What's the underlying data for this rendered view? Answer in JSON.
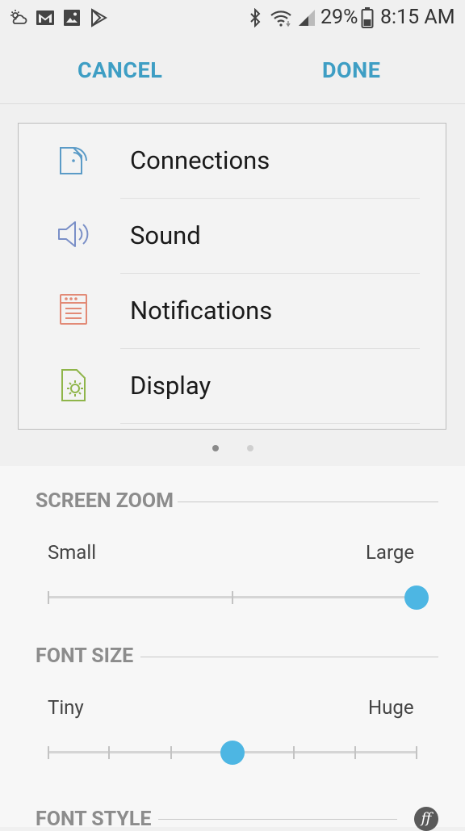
{
  "status_bar": {
    "battery_percent": "29%",
    "time": "8:15 AM",
    "left_icons": [
      "weather-icon",
      "gmail-icon",
      "gallery-icon",
      "play-store-icon"
    ],
    "right_icons": [
      "bluetooth-icon",
      "wifi-icon",
      "signal-icon",
      "battery-icon"
    ]
  },
  "action_bar": {
    "cancel_label": "CANCEL",
    "done_label": "DONE"
  },
  "preview": {
    "items": [
      {
        "label": "Connections",
        "icon": "connections-icon",
        "color": "#5b9bc7"
      },
      {
        "label": "Sound",
        "icon": "speaker-icon",
        "color": "#7a8fc7"
      },
      {
        "label": "Notifications",
        "icon": "notifications-icon",
        "color": "#e28a76"
      },
      {
        "label": "Display",
        "icon": "display-icon",
        "color": "#8fb54a"
      }
    ],
    "pager": {
      "pages": 2,
      "active": 1
    }
  },
  "screen_zoom": {
    "title": "SCREEN ZOOM",
    "min_label": "Small",
    "max_label": "Large",
    "steps": 3,
    "selected_step": 3
  },
  "font_size": {
    "title": "FONT SIZE",
    "min_label": "Tiny",
    "max_label": "Huge",
    "steps": 7,
    "selected_step": 4
  },
  "font_style": {
    "title": "FONT STYLE"
  },
  "colors": {
    "accent": "#3e9ec4",
    "slider_thumb": "#4db6e3"
  }
}
